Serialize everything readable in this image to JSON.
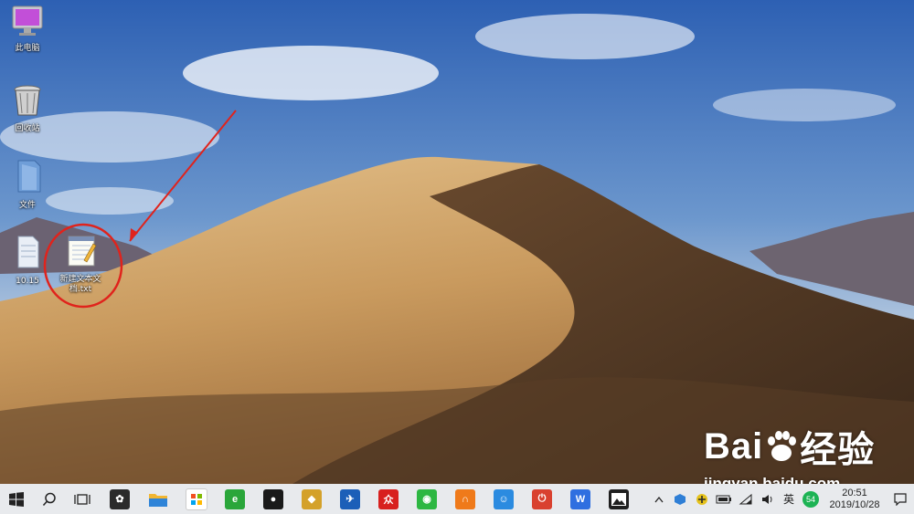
{
  "desktop": {
    "icons": [
      {
        "label": "此电脑",
        "icon": "computer-icon"
      },
      {
        "label": "回收站",
        "icon": "recycle-bin-icon"
      },
      {
        "label": "文件",
        "icon": "folder-icon"
      },
      {
        "label": "10.15",
        "icon": "file-icon"
      },
      {
        "label": "新建文本文档.txt",
        "icon": "text-document-icon"
      }
    ],
    "annotation": {
      "color": "#e0231c"
    }
  },
  "watermark": {
    "brand": "Bai",
    "brand_cn": "经验",
    "url": "jingyan.baidu.com"
  },
  "taskbar": {
    "start_icon": "windows-logo-icon",
    "search_icon": "search-icon",
    "task_view_icon": "task-view-icon",
    "pinned": [
      {
        "name": "pinwheel-app-icon",
        "color": "#2b2b2b",
        "glyph": "✿"
      },
      {
        "name": "file-explorer-icon",
        "color": "#f2b632",
        "glyph": ""
      },
      {
        "name": "microsoft-store-icon",
        "color": "#ffffff",
        "glyph": ""
      },
      {
        "name": "green-browser-icon",
        "color": "#2aa63a",
        "glyph": "e"
      },
      {
        "name": "qq-penguin-icon",
        "color": "#1a1a1a",
        "glyph": "●"
      },
      {
        "name": "gold-badge-icon",
        "color": "#d4a12a",
        "glyph": "◆"
      },
      {
        "name": "tools-app-icon",
        "color": "#1c5fb8",
        "glyph": "✈"
      },
      {
        "name": "red-app-icon",
        "color": "#d8201e",
        "glyph": "众"
      },
      {
        "name": "wechat-icon",
        "color": "#2db742",
        "glyph": "◉"
      },
      {
        "name": "orange-ring-icon",
        "color": "#ef7a1a",
        "glyph": "∩"
      },
      {
        "name": "blue-mascot-icon",
        "color": "#2b8be0",
        "glyph": "☺"
      },
      {
        "name": "power-app-icon",
        "color": "#d9412f",
        "glyph": "⏻"
      },
      {
        "name": "wps-icon",
        "color": "#2f6fe0",
        "glyph": "W"
      },
      {
        "name": "photos-icon",
        "color": "#1f1f1f",
        "glyph": "▲"
      }
    ],
    "tray": {
      "chevron_icon": "chevron-up-icon",
      "language": "英",
      "badge": "54",
      "time": "20:51",
      "date": "2019/10/28",
      "notification_icon": "notification-icon"
    }
  }
}
